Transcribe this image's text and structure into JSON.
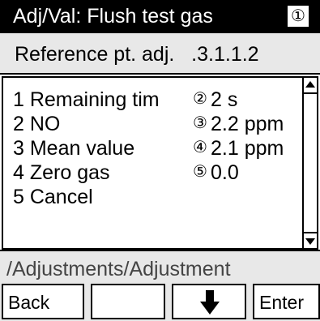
{
  "title_bar": {
    "title": "Adj/Val: Flush test gas",
    "callout": "①"
  },
  "header": {
    "text": "Reference pt. adj.   .3.1.1.2"
  },
  "menu": {
    "items": [
      {
        "label": "1 Remaining tim",
        "callout": "②",
        "value": "2 s"
      },
      {
        "label": "2 NO",
        "callout": "③",
        "value": "2.2 ppm"
      },
      {
        "label": "3 Mean value",
        "callout": "④",
        "value": "2.1 ppm"
      },
      {
        "label": "4 Zero gas",
        "callout": "⑤",
        "value": "0.0"
      },
      {
        "label": "5 Cancel"
      }
    ]
  },
  "path": {
    "text": "/Adjustments/Adjustment"
  },
  "softkeys": {
    "back": "Back",
    "blank": "",
    "down_icon": "arrow-down-icon",
    "enter": "Enter"
  }
}
